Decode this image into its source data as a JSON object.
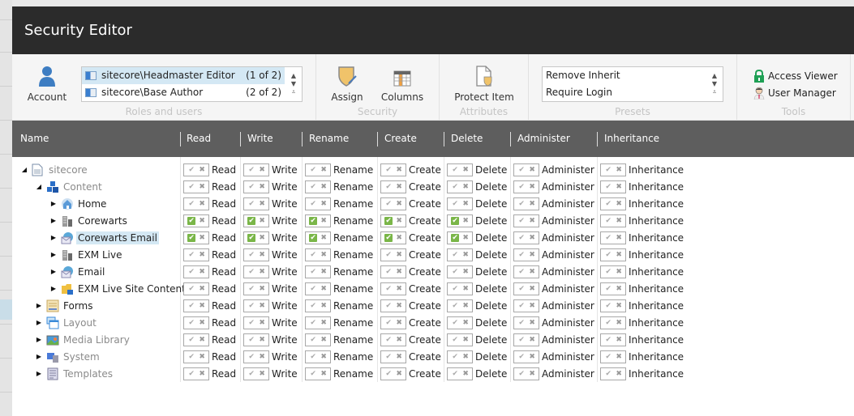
{
  "window": {
    "title": "Security Editor"
  },
  "ribbon": {
    "account": {
      "label": "Account"
    },
    "roles": {
      "group_label": "Roles and users",
      "items": [
        {
          "name": "sitecore\\Headmaster Editor",
          "count": "(1 of 2)",
          "selected": true
        },
        {
          "name": "sitecore\\Base Author",
          "count": "(2 of 2)",
          "selected": false
        }
      ]
    },
    "security": {
      "group_label": "Security",
      "assign_label": "Assign",
      "columns_label": "Columns"
    },
    "attributes": {
      "group_label": "Attributes",
      "protect_label": "Protect Item"
    },
    "presets": {
      "group_label": "Presets",
      "items": [
        "Remove Inherit",
        "Require Login"
      ]
    },
    "tools": {
      "group_label": "Tools",
      "access_viewer_label": "Access Viewer",
      "user_manager_label": "User Manager"
    }
  },
  "grid": {
    "columns": [
      "Name",
      "Read",
      "Write",
      "Rename",
      "Create",
      "Delete",
      "Administer",
      "Inheritance"
    ],
    "rows": [
      {
        "name": "sitecore",
        "level": 0,
        "expanded": true,
        "icon": "document-icon",
        "dim": true,
        "highlight": false,
        "allowed": [
          false,
          false,
          false,
          false,
          false,
          false,
          false
        ]
      },
      {
        "name": "Content",
        "level": 1,
        "expanded": true,
        "icon": "content-cubes-icon",
        "dim": true,
        "highlight": false,
        "allowed": [
          false,
          false,
          false,
          false,
          false,
          false,
          false
        ]
      },
      {
        "name": "Home",
        "level": 2,
        "expanded": false,
        "icon": "home-icon",
        "dim": false,
        "highlight": false,
        "allowed": [
          false,
          false,
          false,
          false,
          false,
          false,
          false
        ]
      },
      {
        "name": "Corewarts",
        "level": 2,
        "expanded": false,
        "icon": "building-icon",
        "dim": false,
        "highlight": false,
        "allowed": [
          true,
          true,
          true,
          true,
          true,
          false,
          false
        ]
      },
      {
        "name": "Corewarts Email",
        "level": 2,
        "expanded": false,
        "icon": "email-icon",
        "dim": false,
        "highlight": true,
        "allowed": [
          true,
          true,
          true,
          true,
          true,
          false,
          false
        ]
      },
      {
        "name": "EXM Live",
        "level": 2,
        "expanded": false,
        "icon": "building-icon",
        "dim": false,
        "highlight": false,
        "allowed": [
          false,
          false,
          false,
          false,
          false,
          false,
          false
        ]
      },
      {
        "name": "Email",
        "level": 2,
        "expanded": false,
        "icon": "email-icon",
        "dim": false,
        "highlight": false,
        "allowed": [
          false,
          false,
          false,
          false,
          false,
          false,
          false
        ]
      },
      {
        "name": "EXM Live Site Content",
        "level": 2,
        "expanded": false,
        "icon": "folder-icon",
        "dim": false,
        "highlight": false,
        "allowed": [
          false,
          false,
          false,
          false,
          false,
          false,
          false
        ]
      },
      {
        "name": "Forms",
        "level": 1,
        "expanded": false,
        "icon": "forms-icon",
        "dim": false,
        "highlight": false,
        "allowed": [
          false,
          false,
          false,
          false,
          false,
          false,
          false
        ]
      },
      {
        "name": "Layout",
        "level": 1,
        "expanded": false,
        "icon": "layout-icon",
        "dim": true,
        "highlight": false,
        "allowed": [
          false,
          false,
          false,
          false,
          false,
          false,
          false
        ]
      },
      {
        "name": "Media Library",
        "level": 1,
        "expanded": false,
        "icon": "media-icon",
        "dim": true,
        "highlight": false,
        "allowed": [
          false,
          false,
          false,
          false,
          false,
          false,
          false
        ]
      },
      {
        "name": "System",
        "level": 1,
        "expanded": false,
        "icon": "system-icon",
        "dim": true,
        "highlight": false,
        "allowed": [
          false,
          false,
          false,
          false,
          false,
          false,
          false
        ]
      },
      {
        "name": "Templates",
        "level": 1,
        "expanded": false,
        "icon": "templates-icon",
        "dim": true,
        "highlight": false,
        "allowed": [
          false,
          false,
          false,
          false,
          false,
          false,
          false
        ]
      }
    ]
  },
  "colors": {
    "titlebar": "#2b2b2b",
    "grid_header": "#5e5e5e",
    "allow_green": "#7ab648",
    "selection": "#d4e8f4"
  }
}
